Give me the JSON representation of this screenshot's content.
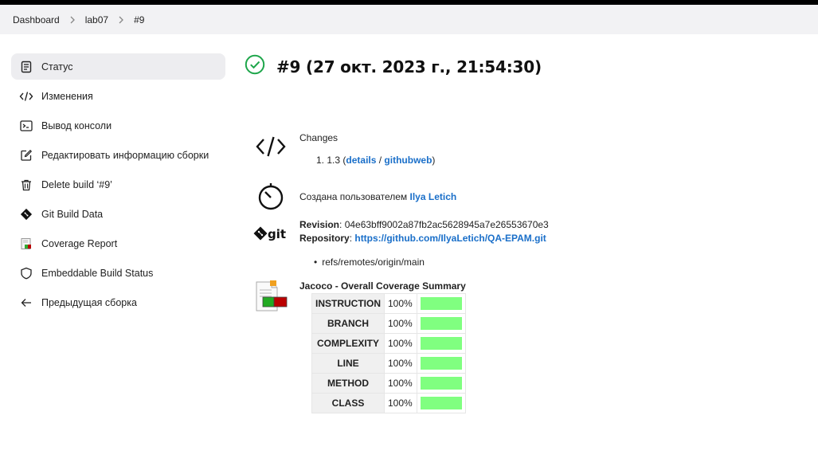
{
  "breadcrumbs": [
    {
      "label": "Dashboard"
    },
    {
      "label": "lab07"
    },
    {
      "label": "#9"
    }
  ],
  "sidebar": {
    "items": [
      {
        "label": "Статус",
        "icon": "document-icon"
      },
      {
        "label": "Изменения",
        "icon": "code-icon"
      },
      {
        "label": "Вывод консоли",
        "icon": "terminal-icon"
      },
      {
        "label": "Редактировать информацию сборки",
        "icon": "edit-icon"
      },
      {
        "label": "Delete build ‘#9’",
        "icon": "trash-icon"
      },
      {
        "label": "Git Build Data",
        "icon": "git-icon"
      },
      {
        "label": "Coverage Report",
        "icon": "coverage-report-icon"
      },
      {
        "label": "Embeddable Build Status",
        "icon": "shield-icon"
      },
      {
        "label": "Предыдущая сборка",
        "icon": "arrow-left-icon"
      }
    ]
  },
  "build": {
    "title": "#9 (27 окт. 2023 г., 21:54:30)",
    "status": "success",
    "status_color": "#1ea64b"
  },
  "changes": {
    "heading": "Changes",
    "item_number": "1.",
    "item_text": "1.3",
    "details_link": "details",
    "githubweb_link": "githubweb"
  },
  "started_by": {
    "text": "Создана пользователем",
    "user": "Ilya Letich"
  },
  "git": {
    "revision_label": "Revision",
    "revision": "04e63bff9002a87fb2ac5628945a7e26553670e3",
    "repository_label": "Repository",
    "repository_url": "https://github.com/IlyaLetich/QA-EPAM.git",
    "branch": "refs/remotes/origin/main"
  },
  "jacoco": {
    "heading": "Jacoco - Overall Coverage Summary",
    "bar_color": "#80ff80",
    "rows": [
      {
        "name": "INSTRUCTION",
        "percent": "100%",
        "value": 1.0
      },
      {
        "name": "BRANCH",
        "percent": "100%",
        "value": 1.0
      },
      {
        "name": "COMPLEXITY",
        "percent": "100%",
        "value": 1.0
      },
      {
        "name": "LINE",
        "percent": "100%",
        "value": 1.0
      },
      {
        "name": "METHOD",
        "percent": "100%",
        "value": 1.0
      },
      {
        "name": "CLASS",
        "percent": "100%",
        "value": 1.0
      }
    ]
  }
}
